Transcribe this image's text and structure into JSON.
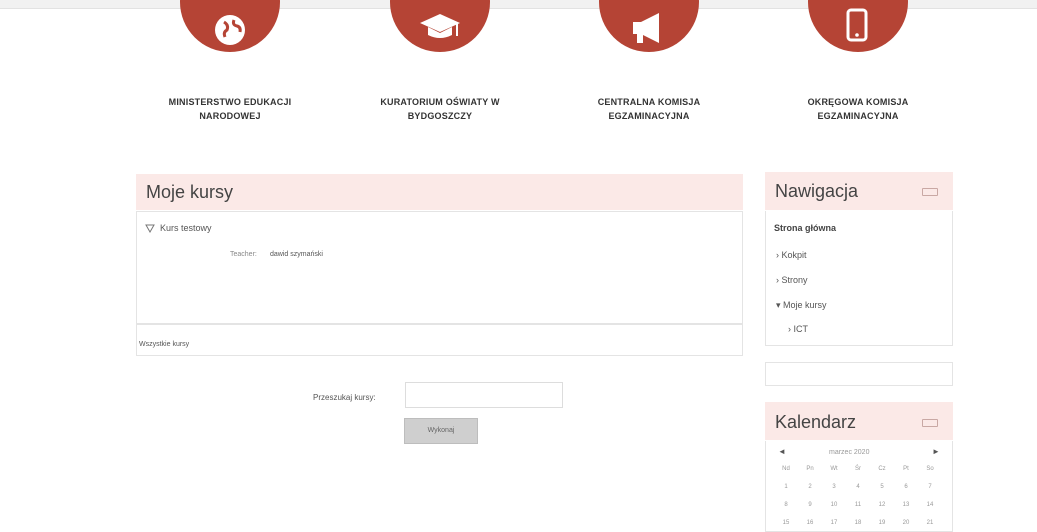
{
  "header_links": [
    {
      "line1": "MINISTERSTWO EDUKACJI",
      "line2": "NARODOWEJ",
      "icon": "globe-icon"
    },
    {
      "line1": "KURATORIUM OŚWIATY W",
      "line2": "BYDGOSZCZY",
      "icon": "graduation-cap-icon"
    },
    {
      "line1": "CENTRALNA KOMISJA",
      "line2": "EGZAMINACYJNA",
      "icon": "megaphone-icon"
    },
    {
      "line1": "OKRĘGOWA KOMISJA",
      "line2": "EGZAMINACYJNA",
      "icon": "mobile-icon"
    }
  ],
  "colors": {
    "accent": "#b54435",
    "block_header_bg": "#fbe9e7"
  },
  "my_courses": {
    "title": "Moje kursy",
    "course_name": "Kurs testowy",
    "teacher_label": "Teacher:",
    "teacher_name": "dawid szymański",
    "all_courses_link": "Wszystkie kursy"
  },
  "search": {
    "label": "Przeszukaj kursy:",
    "value": "",
    "button": "Wykonaj"
  },
  "navigation": {
    "title": "Nawigacja",
    "home": "Strona główna",
    "items": [
      "Kokpit",
      "Strony",
      "Moje kursy"
    ],
    "subitems": [
      "ICT"
    ]
  },
  "calendar": {
    "title": "Kalendarz",
    "month": "marzec 2020",
    "prev": "◄",
    "next": "►",
    "weekdays": [
      "Nd",
      "Pn",
      "Wt",
      "Śr",
      "Cz",
      "Pt",
      "So"
    ],
    "rows": [
      [
        "1",
        "2",
        "3",
        "4",
        "5",
        "6",
        "7"
      ],
      [
        "8",
        "9",
        "10",
        "11",
        "12",
        "13",
        "14"
      ],
      [
        "15",
        "16",
        "17",
        "18",
        "19",
        "20",
        "21"
      ]
    ]
  }
}
